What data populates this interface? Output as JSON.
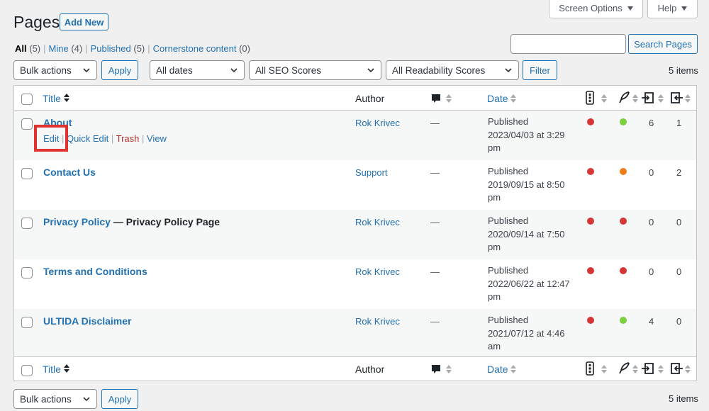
{
  "top_tabs": {
    "screen_options": "Screen Options",
    "help": "Help"
  },
  "header": {
    "title": "Pages",
    "add_new": "Add New"
  },
  "views": [
    {
      "label": "All",
      "count": "(5)",
      "current": true
    },
    {
      "label": "Mine",
      "count": "(4)"
    },
    {
      "label": "Published",
      "count": "(5)"
    },
    {
      "label": "Cornerstone content",
      "count": "(0)"
    }
  ],
  "search": {
    "value": "",
    "button": "Search Pages"
  },
  "filters": {
    "bulk_actions": "Bulk actions",
    "apply": "Apply",
    "dates": "All dates",
    "seo": "All SEO Scores",
    "readability": "All Readability Scores",
    "filter": "Filter",
    "items": "5 items"
  },
  "columns": {
    "title": "Title",
    "author": "Author",
    "date": "Date"
  },
  "colors": {
    "red": "#d63638",
    "green": "#7ad03a",
    "orange": "#ee7c1b",
    "link": "#2271b1",
    "highlight": "#e0322f"
  },
  "rows": [
    {
      "title": "About",
      "state": "",
      "author": "Rok Krivec",
      "comments": "—",
      "date_status": "Published",
      "date_line1": "2023/04/03 at 3:29",
      "date_line2": "pm",
      "seo": "red",
      "readability": "green",
      "links_out": "6",
      "links_in": "1",
      "actions": {
        "edit": "Edit",
        "quick_edit": "Quick Edit",
        "trash": "Trash",
        "view": "View"
      }
    },
    {
      "title": "Contact Us",
      "state": "",
      "author": "Support",
      "comments": "—",
      "date_status": "Published",
      "date_line1": "2019/09/15 at 8:50",
      "date_line2": "pm",
      "seo": "red",
      "readability": "orange",
      "links_out": "0",
      "links_in": "2"
    },
    {
      "title": "Privacy Policy",
      "state": " — Privacy Policy Page",
      "author": "Rok Krivec",
      "comments": "—",
      "date_status": "Published",
      "date_line1": "2020/09/14 at 7:50",
      "date_line2": "pm",
      "seo": "red",
      "readability": "red",
      "links_out": "0",
      "links_in": "0"
    },
    {
      "title": "Terms and Conditions",
      "state": "",
      "author": "Rok Krivec",
      "comments": "—",
      "date_status": "Published",
      "date_line1": "2022/06/22 at 12:47",
      "date_line2": "pm",
      "seo": "red",
      "readability": "red",
      "links_out": "0",
      "links_in": "0"
    },
    {
      "title": "ULTIDA Disclaimer",
      "state": "",
      "author": "Rok Krivec",
      "comments": "—",
      "date_status": "Published",
      "date_line1": "2021/07/12 at 4:46",
      "date_line2": "am",
      "seo": "red",
      "readability": "green",
      "links_out": "4",
      "links_in": "0"
    }
  ]
}
